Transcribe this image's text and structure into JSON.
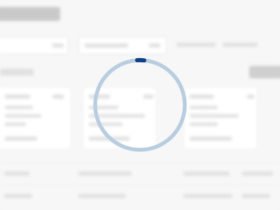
{
  "spinner": {
    "ring_color": "#b9cde0",
    "arc_color": "#0f3f86",
    "state": "loading"
  },
  "background": {
    "page_color": "#f7f7f7",
    "content_blurred": true
  }
}
